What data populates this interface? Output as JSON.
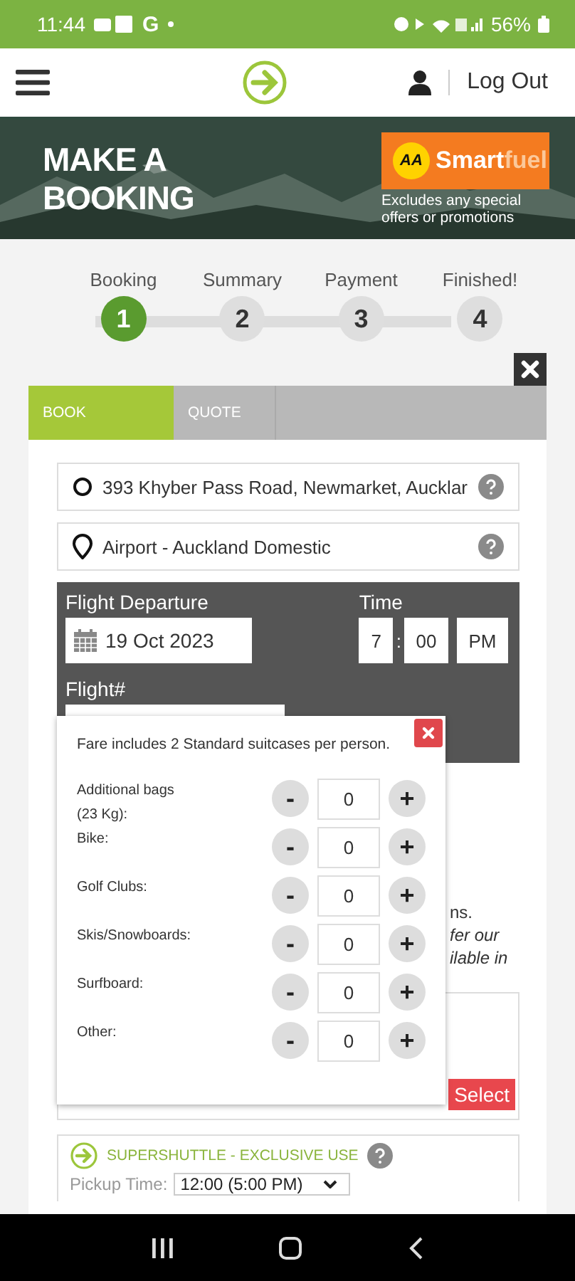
{
  "status_bar": {
    "time": "11:44",
    "carrier_letter": "G",
    "battery": "56%"
  },
  "header": {
    "logout": "Log Out"
  },
  "banner": {
    "title_lines": [
      "MAKE A",
      "BOOKING"
    ],
    "logo_aa": "AA",
    "logo_smart": "Smart",
    "logo_fuel": "fuel",
    "note": "Excludes any special offers or promotions"
  },
  "steps": [
    {
      "label": "Booking",
      "number": "1",
      "selected": true
    },
    {
      "label": "Summary",
      "number": "2",
      "selected": false
    },
    {
      "label": "Payment",
      "number": "3",
      "selected": false
    },
    {
      "label": "Finished!",
      "number": "4",
      "selected": false
    }
  ],
  "tabs": [
    {
      "label": "BOOK",
      "selected": true
    },
    {
      "label": "QUOTE",
      "selected": false
    }
  ],
  "locations": [
    {
      "kind": "origin",
      "value": "393 Khyber Pass Road, Newmarket, Aucklar"
    },
    {
      "kind": "destination",
      "value": "Airport - Auckland Domestic"
    }
  ],
  "flight": {
    "departure_label": "Flight Departure",
    "date": "19 Oct 2023",
    "time_label": "Time",
    "hour": "7",
    "separator": ":",
    "minute": "00",
    "period": "PM",
    "flight_label": "Flight#"
  },
  "luggage_popup": {
    "note": "Fare includes 2 Standard suitcases per person.",
    "minus": "-",
    "plus": "+",
    "items": [
      {
        "label": "Additional bags (23 Kg):",
        "value": "0"
      },
      {
        "label": "Bike:",
        "value": "0"
      },
      {
        "label": "Golf Clubs:",
        "value": "0"
      },
      {
        "label": "Skis/Snowboards:",
        "value": "0"
      },
      {
        "label": "Surfboard:",
        "value": "0"
      },
      {
        "label": "Other:",
        "value": "0"
      }
    ]
  },
  "hidden_notice_fragments": [
    "ns.",
    "fer our",
    "ilable in"
  ],
  "result": {
    "select": "Select"
  },
  "service": {
    "name": "SUPERSHUTTLE - EXCLUSIVE USE",
    "pickup_label": "Pickup Time:",
    "pickup_value": "12:00 (5:00 PM)"
  }
}
